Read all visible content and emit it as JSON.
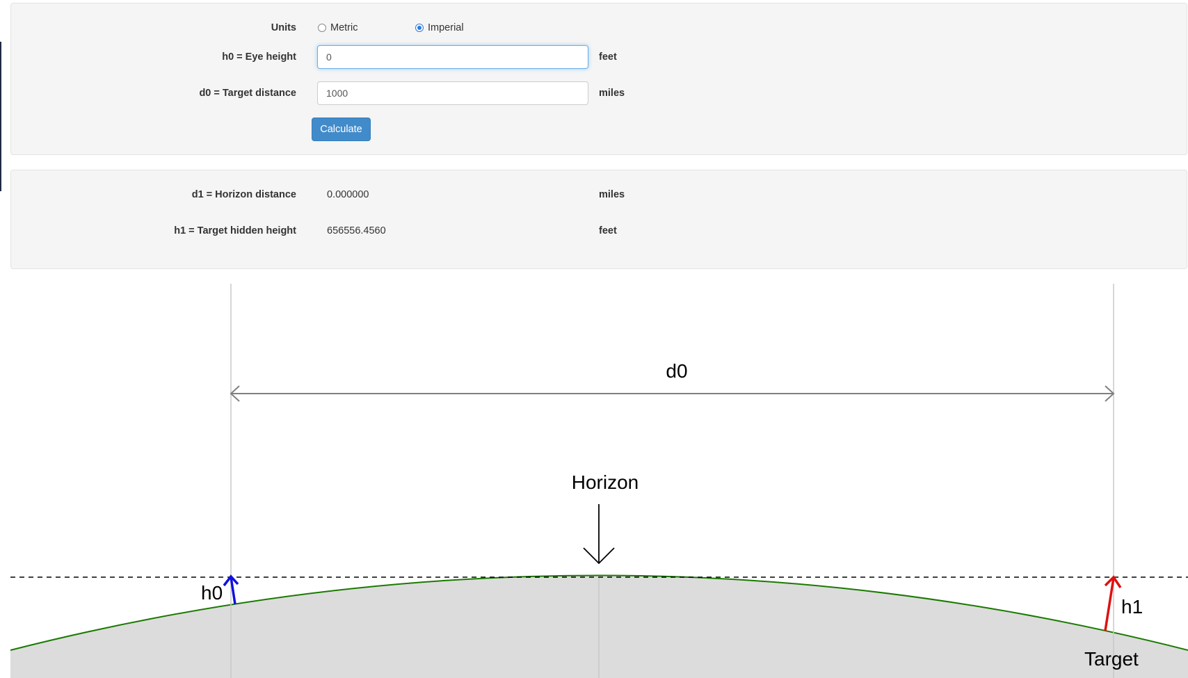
{
  "form": {
    "units_label": "Units",
    "units_options": [
      "Metric",
      "Imperial"
    ],
    "units_selected": "Imperial",
    "eye_height_label": "h0 = Eye height",
    "eye_height_value": "0",
    "eye_height_unit": "feet",
    "target_distance_label": "d0 = Target distance",
    "target_distance_value": "1000",
    "target_distance_unit": "miles",
    "calculate_label": "Calculate"
  },
  "results": {
    "horizon_distance_label": "d1 = Horizon distance",
    "horizon_distance_value": "0.000000",
    "horizon_distance_unit": "miles",
    "hidden_height_label": "h1 = Target hidden height",
    "hidden_height_value": "656556.4560",
    "hidden_height_unit": "feet"
  },
  "diagram": {
    "d0_label": "d0",
    "horizon_label": "Horizon",
    "h0_label": "h0",
    "h1_label": "h1",
    "target_label": "Target",
    "colors": {
      "earth_fill": "#dcdcdc",
      "earth_edge": "#1a7a00",
      "h0_arrow": "#1010e0",
      "h1_arrow": "#e01010",
      "guide": "#c8c8c8",
      "dimension": "#808080"
    }
  }
}
